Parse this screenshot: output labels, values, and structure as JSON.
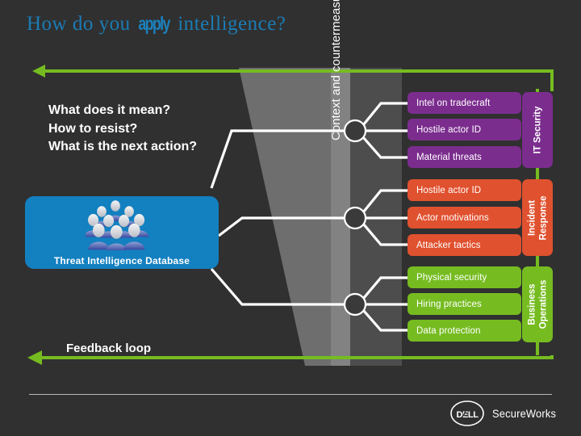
{
  "slide": {
    "title_prefix": "How do you ",
    "title_emphasis": "apply",
    "title_suffix": " intelligence?",
    "background_color": "#303030"
  },
  "questions": {
    "line1": "What does it mean?",
    "line2": "How to resist?",
    "line3": "What is the next action?"
  },
  "database": {
    "label": "Threat Intelligence Database",
    "icon": "people-group-icon",
    "color": "#1380c0"
  },
  "funnel": {
    "label": "Context and countermeasures"
  },
  "feedback": {
    "label": "Feedback loop",
    "arrow_color": "#76bc21"
  },
  "groups": [
    {
      "category": "IT Security",
      "category_lines": [
        "IT Security"
      ],
      "color": "#7b2d8e",
      "items": [
        "Intel on tradecraft",
        "Hostile actor ID",
        "Material threats"
      ]
    },
    {
      "category": "Incident Response",
      "category_lines": [
        "Incident",
        "Response"
      ],
      "color": "#e0512f",
      "items": [
        "Hostile actor ID",
        "Actor motivations",
        "Attacker tactics"
      ]
    },
    {
      "category": "Business Operations",
      "category_lines": [
        "Business",
        "Operations"
      ],
      "color": "#76bc21",
      "items": [
        "Physical security",
        "Hiring practices",
        "Data protection"
      ]
    }
  ],
  "footer": {
    "brand_mark": "DELL",
    "brand_name": "SecureWorks"
  }
}
